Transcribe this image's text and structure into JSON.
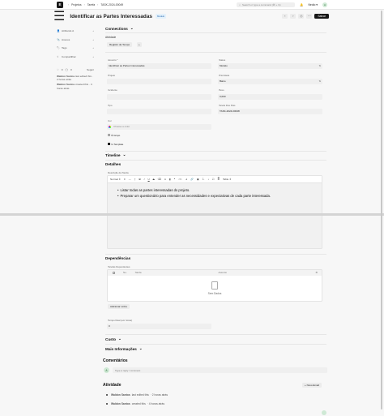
{
  "nav": {
    "breadcrumbs": [
      "Projetos",
      "Tarefa",
      "TASK-2024-00049"
    ],
    "search_placeholder": "Search or type a command (⌘ + G)",
    "user": "Nedio",
    "avatar": "A"
  },
  "header": {
    "title": "Identificar as Partes Interessadas",
    "status": "Modelo",
    "save_label": "Salvar"
  },
  "sidebar": {
    "items": [
      {
        "icon": "user-icon",
        "label": "Atribuído A"
      },
      {
        "icon": "paperclip-icon",
        "label": "Anexos"
      },
      {
        "icon": "tag-icon",
        "label": "Tags"
      },
      {
        "icon": "share-icon",
        "label": "Compartilhar"
      }
    ],
    "likes": "0",
    "comments": "0",
    "follow_label": "Seguir",
    "activity": [
      {
        "user": "Waldon Santos",
        "action": "last edited this",
        "time": "· 2 horas atrás"
      },
      {
        "user": "Waldon Santos",
        "action": "created this",
        "time": "· 4 horas atrás"
      }
    ]
  },
  "form": {
    "connections_title": "Connections",
    "activity_title": "Atividade",
    "timesheet_button": "Registro de Tempo",
    "assunto_label": "Assunto *",
    "assunto_value": "Identificar as Partes Interessadas",
    "projeto_label": "Projeto",
    "issue_label": "Incidente",
    "tipo_label": "Tipo",
    "cor_label": "Cor",
    "cor_placeholder": "Choose a color",
    "grupo_label": "É Grupo",
    "template_label": "Is Template",
    "status_label": "Status",
    "status_value": "Modelo",
    "prioridade_label": "Prioridade",
    "prioridade_value": "Baixo",
    "peso_label": "Peso",
    "peso_value": "0,000",
    "parent_label": "Tarefa Dos Pais",
    "parent_value": "TASK-2024-00048",
    "timeline_title": "Timeline",
    "detalhes_title": "Detalhes",
    "descricao_label": "Descrição da Tarefa",
    "toolbar_style": "Normal",
    "toolbar_table": "Table",
    "bullets": [
      "Listar todas as partes interessadas do projeto.",
      "Preparar um questionário para entender as necessidades e expectativas de cada parte interessada."
    ],
    "dependencias_title": "Dependências",
    "dep_label": "Tarefas Dependentes",
    "table_headers": [
      "No.",
      "Tarefa",
      "Assunto"
    ],
    "empty_text": "Sem Dados",
    "add_row": "Adicionar Linha",
    "tempo_label": "Tempo Real (em horas)",
    "tempo_value": "0",
    "custo_title": "Custo",
    "mais_title": "Mais Informações"
  },
  "comments": {
    "title": "Comentários",
    "avatar": "A",
    "placeholder": "Type a reply / comment"
  },
  "activity": {
    "title": "Atividade",
    "new_email": "+ Novo Email",
    "items": [
      {
        "user": "Waldon Santos",
        "action": "last edited this",
        "time": "· 2 horas atrás"
      },
      {
        "user": "Waldon Santos",
        "action": "created this",
        "time": "· 4 horas atrás"
      }
    ]
  }
}
